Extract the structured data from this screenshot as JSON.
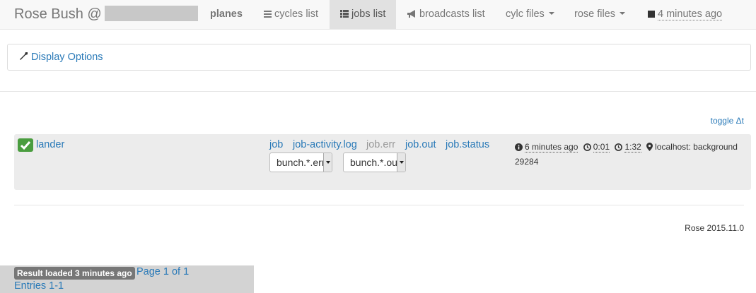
{
  "navbar": {
    "brand": "Rose Bush @",
    "suite": "planes",
    "tabs": [
      {
        "label": "cycles list",
        "icon": "list-icon"
      },
      {
        "label": "jobs list",
        "icon": "th-list-icon",
        "active": true
      },
      {
        "label": "broadcasts list",
        "icon": "bullhorn-icon"
      }
    ],
    "menus": [
      {
        "label": "cylc files"
      },
      {
        "label": "rose files"
      }
    ],
    "updated": "4 minutes ago"
  },
  "display_options": {
    "label": "Display Options",
    "icon": "wrench-icon"
  },
  "toggle_dt": "toggle Δt",
  "job": {
    "status_icon": "check-icon",
    "status_color": "#4a9d3f",
    "name": "lander",
    "files": [
      "job",
      "job-activity.log",
      "job.err",
      "job.out",
      "job.status"
    ],
    "selects": [
      "bunch.*.err",
      "bunch.*.out"
    ],
    "submitted": "6 minutes ago",
    "queue_time": "0:01",
    "run_time": "1:32",
    "host": "localhost: background",
    "pid": "29284"
  },
  "version": "Rose 2015.11.0",
  "status": {
    "result": "Result loaded 3 minutes ago",
    "page": "Page 1 of 1",
    "entries": "Entries 1-1"
  },
  "colors": {
    "link": "#2a7ab8",
    "active_tab": "#e1e1e1",
    "success": "#4a9d3f"
  }
}
